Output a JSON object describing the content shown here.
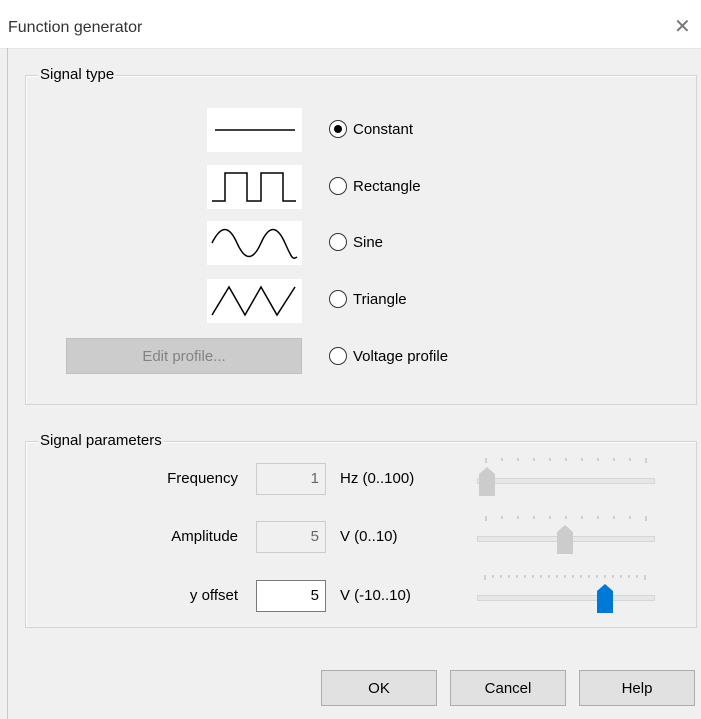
{
  "window": {
    "title": "Function generator",
    "close_glyph": "✕"
  },
  "signal_type": {
    "group_label": "Signal type",
    "options": [
      {
        "label": "Constant",
        "icon": "constant-wave-icon",
        "selected": true
      },
      {
        "label": "Rectangle",
        "icon": "rectangle-wave-icon",
        "selected": false
      },
      {
        "label": "Sine",
        "icon": "sine-wave-icon",
        "selected": false
      },
      {
        "label": "Triangle",
        "icon": "triangle-wave-icon",
        "selected": false
      },
      {
        "label": "Voltage profile",
        "icon": null,
        "selected": false
      }
    ],
    "edit_profile_label": "Edit profile..."
  },
  "signal_parameters": {
    "group_label": "Signal parameters",
    "frequency": {
      "label": "Frequency",
      "value": "1",
      "unit": "Hz (0..100)",
      "min": 0,
      "max": 100,
      "slider_value": 1,
      "enabled": false
    },
    "amplitude": {
      "label": "Amplitude",
      "value": "5",
      "unit": "V (0..10)",
      "min": 0,
      "max": 10,
      "slider_value": 5,
      "enabled": false
    },
    "y_offset": {
      "label": "y offset",
      "value": "5",
      "unit": "V (-10..10)",
      "min": -10,
      "max": 10,
      "slider_value": 5,
      "enabled": true
    }
  },
  "buttons": {
    "ok": "OK",
    "cancel": "Cancel",
    "help": "Help"
  },
  "colors": {
    "slider_active_thumb": "#0078d7",
    "slider_disabled_thumb": "#cccccc"
  }
}
